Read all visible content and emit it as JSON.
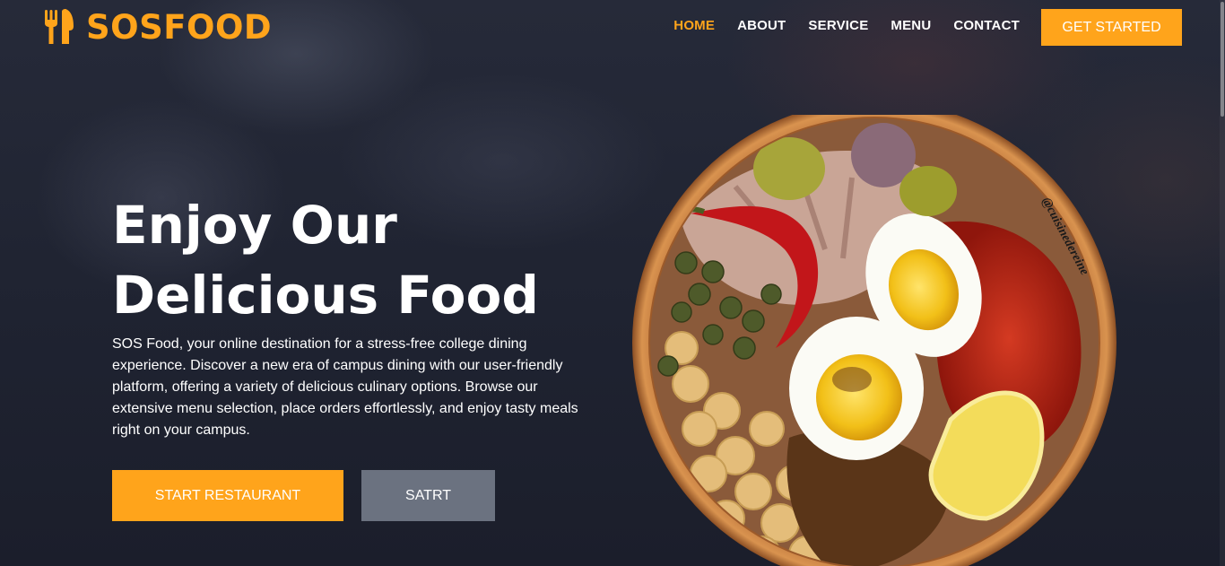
{
  "brand": {
    "name": "SOSFOOD",
    "icon": "fork-knife-icon",
    "accent_color": "#ffa41b"
  },
  "nav": {
    "items": [
      {
        "label": "HOME",
        "active": true
      },
      {
        "label": "ABOUT",
        "active": false
      },
      {
        "label": "SERVICE",
        "active": false
      },
      {
        "label": "MENU",
        "active": false
      },
      {
        "label": "CONTACT",
        "active": false
      }
    ],
    "cta_label": "GET STARTED"
  },
  "hero": {
    "title_line1": "Enjoy Our",
    "title_line2": "Delicious Food",
    "description": "SOS Food, your online destination for a stress-free college dining experience. Discover a new era of campus dining with our user-friendly platform, offering a variety of delicious culinary options. Browse our extensive menu selection, place orders effortlessly, and enjoy tasty meals right on your campus.",
    "primary_button": "START RESTAURANT",
    "secondary_button": "SATRT",
    "image_watermark": "@cuisinedereine"
  },
  "colors": {
    "background": "#1e2230",
    "secondary_button": "#6b7280"
  }
}
